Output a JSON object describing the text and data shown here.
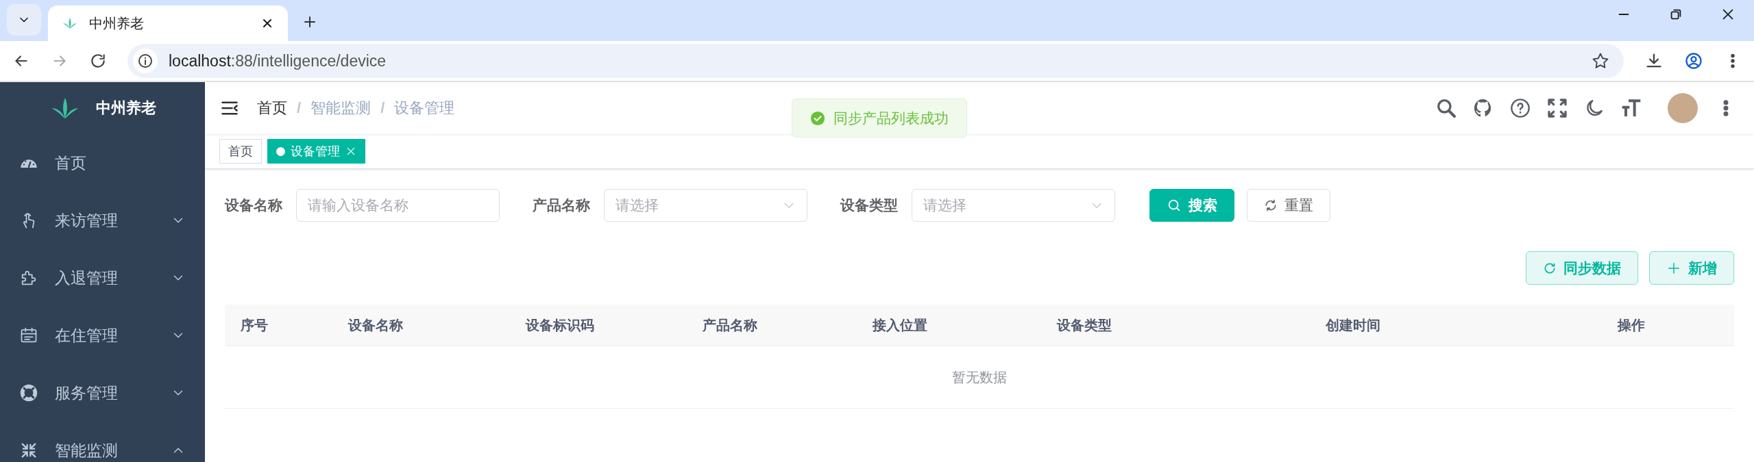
{
  "browser": {
    "tabs": [
      {
        "title": "中州养老",
        "selected": true
      }
    ],
    "url_host": "localhost",
    "url_rest": ":88/intelligence/device"
  },
  "sidebar": {
    "logo_text": "中州养老",
    "items": [
      {
        "label": "首页",
        "kind": "link"
      },
      {
        "label": "来访管理",
        "kind": "submenu",
        "expanded": false
      },
      {
        "label": "入退管理",
        "kind": "submenu",
        "expanded": false
      },
      {
        "label": "在住管理",
        "kind": "submenu",
        "expanded": false
      },
      {
        "label": "服务管理",
        "kind": "submenu",
        "expanded": false
      },
      {
        "label": "智能监测",
        "kind": "submenu",
        "expanded": true
      }
    ]
  },
  "breadcrumb_separator": "/",
  "breadcrumb": [
    {
      "label": "首页",
      "kind": "link"
    },
    {
      "label": "智能监测",
      "kind": "text"
    },
    {
      "label": "设备管理",
      "kind": "text"
    }
  ],
  "tags": [
    {
      "label": "首页",
      "selected": false
    },
    {
      "label": "设备管理",
      "selected": true
    }
  ],
  "toast": {
    "kind": "success",
    "message": "同步产品列表成功"
  },
  "filters": [
    {
      "label": "设备名称",
      "kind": "input",
      "placeholder": "请输入设备名称"
    },
    {
      "label": "产品名称",
      "kind": "select",
      "placeholder": "请选择"
    },
    {
      "label": "设备类型",
      "kind": "select",
      "placeholder": "请选择"
    }
  ],
  "search_button": "搜索",
  "reset_button": "重置",
  "toolbar": [
    {
      "label": "同步数据",
      "kind": "sync"
    },
    {
      "label": "新增",
      "kind": "add"
    }
  ],
  "table": {
    "columns": [
      "序号",
      "设备名称",
      "设备标识码",
      "产品名称",
      "接入位置",
      "设备类型",
      "创建时间",
      "操作"
    ],
    "empty_text": "暂无数据"
  }
}
